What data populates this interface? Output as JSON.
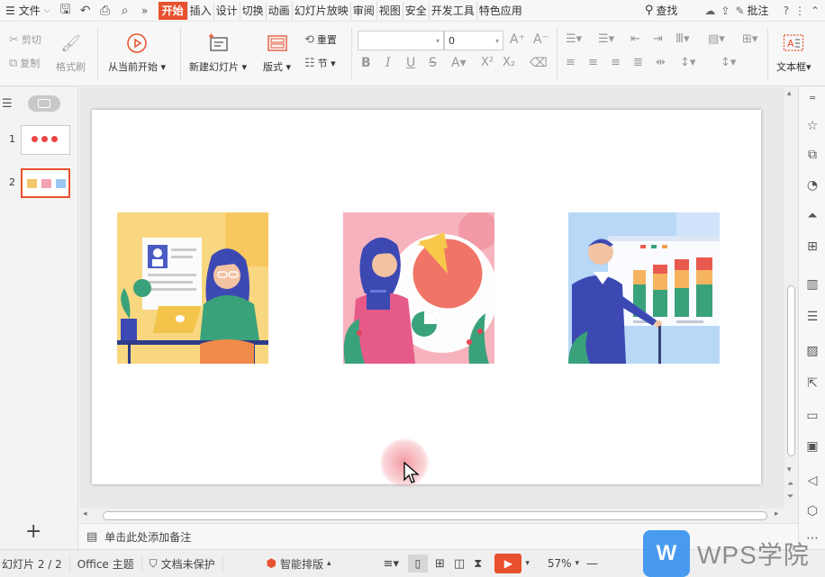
{
  "menubar": {
    "file_label": "文件",
    "tabs": [
      "开始",
      "插入",
      "设计",
      "切换",
      "动画",
      "幻灯片放映",
      "审阅",
      "视图",
      "安全",
      "开发工具",
      "特色应用"
    ],
    "active_tab": "开始",
    "search_label": "查找",
    "comment_label": "批注"
  },
  "ribbon": {
    "cut": "剪切",
    "copy": "复制",
    "format_painter": "格式刷",
    "from_current": "从当前开始",
    "new_slide": "新建幻灯片",
    "layout": "版式",
    "reset": "重置",
    "section": "节",
    "font_size_value": "0",
    "textbox": "文本框"
  },
  "slides_panel": {
    "items": [
      {
        "number": "1"
      },
      {
        "number": "2"
      }
    ],
    "selected": 2
  },
  "notes": {
    "placeholder": "单击此处添加备注"
  },
  "status": {
    "slide_counter": "幻灯片 2 / 2",
    "theme": "Office 主题",
    "protection": "文档未保护",
    "smart_layout": "智能排版",
    "zoom": "57%"
  },
  "watermark": {
    "text": "WPS学院"
  },
  "colors": {
    "accent": "#e8512d",
    "slide_bg": "#ffffff",
    "watermark_blue": "#2a8cf0"
  }
}
